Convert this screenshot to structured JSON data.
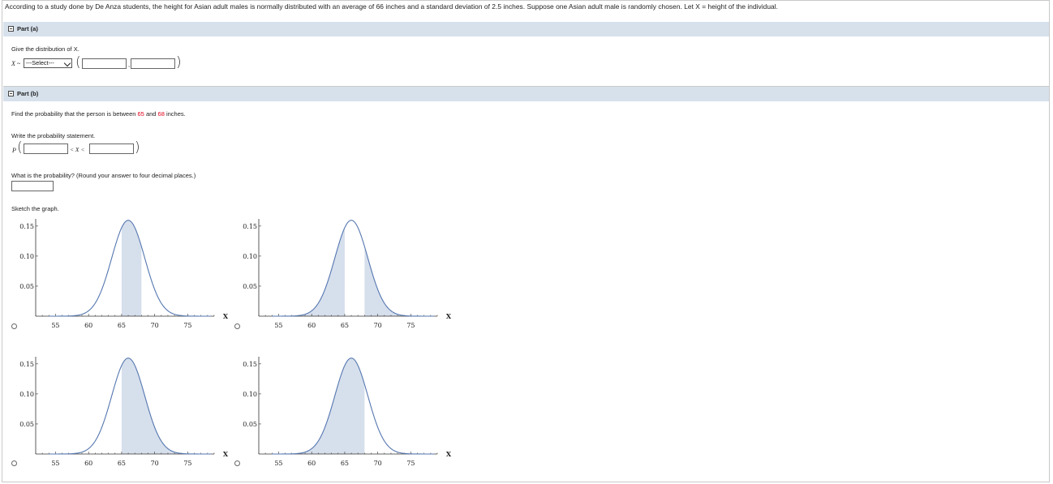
{
  "question": "According to a study done by De Anza students, the height for Asian adult males is normally distributed with an average of 66 inches and a standard deviation of 2.5 inches. Suppose one Asian adult male is randomly chosen. Let X = height of the individual.",
  "part_a": {
    "header": "Part (a)",
    "prompt": "Give the distribution of X.",
    "var_label": "X ~",
    "select_value": "---Select---",
    "param_separator": ","
  },
  "part_b": {
    "header": "Part (b)",
    "prompt_start": "Find the probability that the person is between ",
    "lower": "65",
    "middle": " and ",
    "upper": "68",
    "prompt_end": " inches.",
    "statement_prompt": "Write the probability statement.",
    "p_label": "P",
    "between_label": "< X <",
    "probability_prompt": "What is the probability? (Round your answer to four decimal places.)",
    "sketch_prompt": "Sketch the graph."
  },
  "colors": {
    "curve": "#5577b0",
    "shade": "#d6dfec",
    "header_bg": "#d6e1ec",
    "highlight": "#e0001a"
  },
  "chart_data": [
    {
      "type": "area",
      "x_label": "X",
      "xlim": [
        52,
        79
      ],
      "ylim": [
        0,
        0.17
      ],
      "x_ticks": [
        55,
        60,
        65,
        70,
        75
      ],
      "y_ticks": [
        0.05,
        0.1,
        0.15
      ],
      "mean": 66,
      "sd": 2.5,
      "shaded": [
        [
          65,
          68
        ]
      ]
    },
    {
      "type": "area",
      "x_label": "X",
      "xlim": [
        52,
        79
      ],
      "ylim": [
        0,
        0.17
      ],
      "x_ticks": [
        55,
        60,
        65,
        70,
        75
      ],
      "y_ticks": [
        0.05,
        0.1,
        0.15
      ],
      "mean": 66,
      "sd": 2.5,
      "shaded": [
        [
          52,
          65
        ],
        [
          68,
          79
        ]
      ]
    },
    {
      "type": "area",
      "x_label": "X",
      "xlim": [
        52,
        79
      ],
      "ylim": [
        0,
        0.17
      ],
      "x_ticks": [
        55,
        60,
        65,
        70,
        75
      ],
      "y_ticks": [
        0.05,
        0.1,
        0.15
      ],
      "mean": 66,
      "sd": 2.5,
      "shaded": [
        [
          65,
          79
        ]
      ]
    },
    {
      "type": "area",
      "x_label": "X",
      "xlim": [
        52,
        79
      ],
      "ylim": [
        0,
        0.17
      ],
      "x_ticks": [
        55,
        60,
        65,
        70,
        75
      ],
      "y_ticks": [
        0.05,
        0.1,
        0.15
      ],
      "mean": 66,
      "sd": 2.5,
      "shaded": [
        [
          52,
          68
        ]
      ]
    }
  ]
}
